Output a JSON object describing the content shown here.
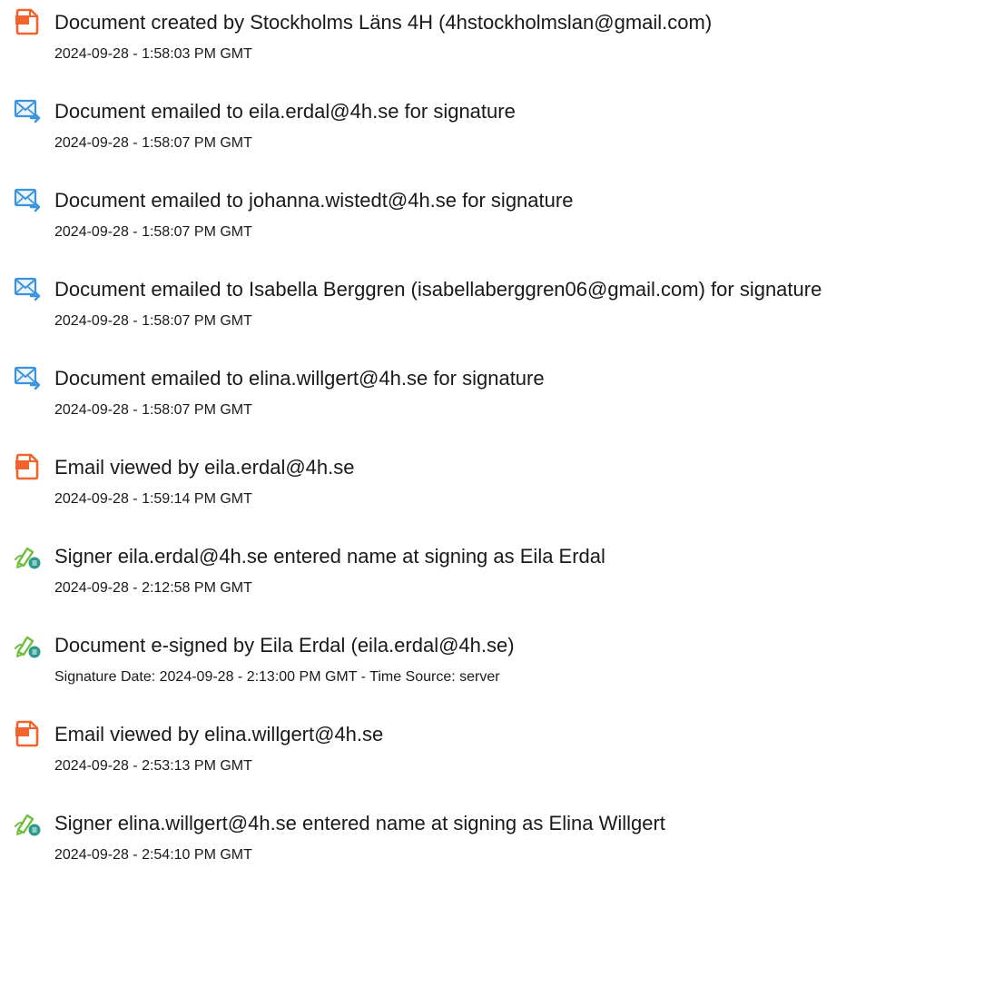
{
  "colors": {
    "doc_icon": "#f0642d",
    "email_icon": "#3b93de",
    "sign_icon_pen": "#6fbf3a",
    "sign_icon_badge": "#2e9a8c"
  },
  "events": [
    {
      "icon": "document-icon",
      "title": "Document created by Stockholms Läns 4H (4hstockholmslan@gmail.com)",
      "time": "2024-09-28 - 1:58:03 PM GMT"
    },
    {
      "icon": "email-icon",
      "title": "Document emailed to eila.erdal@4h.se for signature",
      "time": "2024-09-28 - 1:58:07 PM GMT"
    },
    {
      "icon": "email-icon",
      "title": "Document emailed to johanna.wistedt@4h.se for signature",
      "time": "2024-09-28 - 1:58:07 PM GMT"
    },
    {
      "icon": "email-icon",
      "title": "Document emailed to Isabella Berggren (isabellaberggren06@gmail.com) for signature",
      "time": "2024-09-28 - 1:58:07 PM GMT"
    },
    {
      "icon": "email-icon",
      "title": "Document emailed to elina.willgert@4h.se for signature",
      "time": "2024-09-28 - 1:58:07 PM GMT"
    },
    {
      "icon": "document-icon",
      "title": "Email viewed by eila.erdal@4h.se",
      "time": "2024-09-28 - 1:59:14 PM GMT"
    },
    {
      "icon": "signature-icon",
      "title": "Signer eila.erdal@4h.se entered name at signing as Eila Erdal",
      "time": "2024-09-28 - 2:12:58 PM GMT"
    },
    {
      "icon": "signature-icon",
      "title": "Document e-signed by Eila Erdal (eila.erdal@4h.se)",
      "time": "Signature Date: 2024-09-28 - 2:13:00 PM GMT - Time Source: server"
    },
    {
      "icon": "document-icon",
      "title": "Email viewed by elina.willgert@4h.se",
      "time": "2024-09-28 - 2:53:13 PM GMT"
    },
    {
      "icon": "signature-icon",
      "title": "Signer elina.willgert@4h.se entered name at signing as Elina Willgert",
      "time": "2024-09-28 - 2:54:10 PM GMT"
    }
  ]
}
